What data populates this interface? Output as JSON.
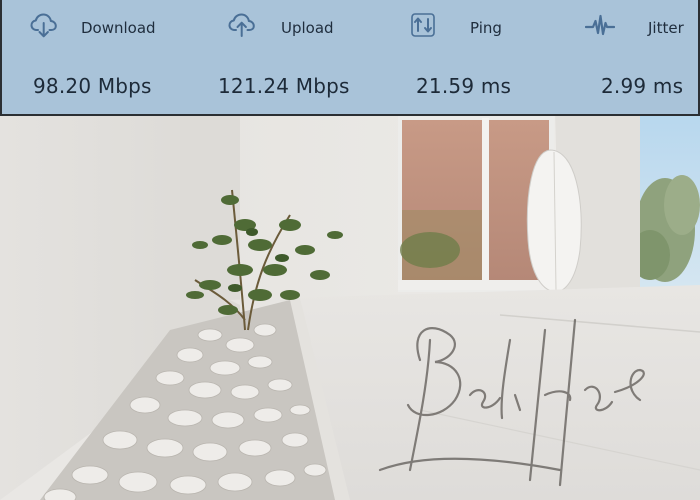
{
  "stats": {
    "download": {
      "label": "Download",
      "value": "98.20 Mbps",
      "icon": "cloud-download-icon"
    },
    "upload": {
      "label": "Upload",
      "value": "121.24 Mbps",
      "icon": "cloud-upload-icon"
    },
    "ping": {
      "label": "Ping",
      "value": "21.59 ms",
      "icon": "ping-arrows-icon"
    },
    "jitter": {
      "label": "Jitter",
      "value": "2.99 ms",
      "icon": "pulse-wave-icon"
    }
  },
  "colors": {
    "bar_background": "#a9c3d9",
    "icon_color": "#4a6f96",
    "text_color": "#1d2a38"
  },
  "photo": {
    "signature_text": "Beli House"
  }
}
